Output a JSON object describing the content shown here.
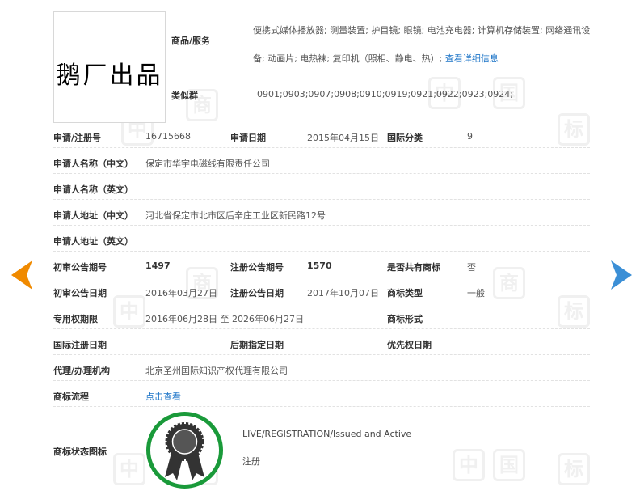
{
  "image_text": "鹅厂出品",
  "goods": {
    "label": "商品/服务",
    "text": "便携式媒体播放器; 测量装置; 护目镜; 眼镜; 电池充电器; 计算机存储装置; 网络通讯设备; 动画片; 电热袜; 复印机（照相、静电、热）;",
    "link": "查看详细信息"
  },
  "similar": {
    "label": "类似群",
    "value": "0901;0903;0907;0908;0910;0919;0921;0922;0923;0924;"
  },
  "fields": {
    "reg_no_label": "申请/注册号",
    "reg_no": "16715668",
    "apply_date_label": "申请日期",
    "apply_date": "2015年04月15日",
    "intl_class_label": "国际分类",
    "intl_class": "9",
    "applicant_cn_label": "申请人名称（中文）",
    "applicant_cn": "保定市华宇电磁线有限责任公司",
    "applicant_en_label": "申请人名称（英文）",
    "address_cn_label": "申请人地址（中文）",
    "address_cn": "河北省保定市北市区后辛庄工业区新民路12号",
    "address_en_label": "申请人地址（英文）",
    "prelim_no_label": "初审公告期号",
    "prelim_no": "1497",
    "reg_pub_no_label": "注册公告期号",
    "reg_pub_no": "1570",
    "shared_label": "是否共有商标",
    "shared": "否",
    "prelim_date_label": "初审公告日期",
    "prelim_date": "2016年03月27日",
    "reg_pub_date_label": "注册公告日期",
    "reg_pub_date": "2017年10月07日",
    "type_label": "商标类型",
    "type": "一般",
    "exclusive_label": "专用权期限",
    "exclusive": "2016年06月28日 至 2026年06月27日",
    "form_label": "商标形式",
    "intl_reg_label": "国际注册日期",
    "later_label": "后期指定日期",
    "priority_label": "优先权日期",
    "agent_label": "代理/办理机构",
    "agent": "北京圣州国际知识产权代理有限公司",
    "flow_label": "商标流程",
    "flow_link": "点击查看",
    "status_label": "商标状态图标",
    "status_en": "LIVE/REGISTRATION/Issued and Active",
    "status_cn": "注册"
  },
  "colors": {
    "arrow_left": "#f08a00",
    "arrow_right": "#3b8fd6",
    "badge_ring": "#1a9a3a",
    "link": "#1a73c7"
  }
}
